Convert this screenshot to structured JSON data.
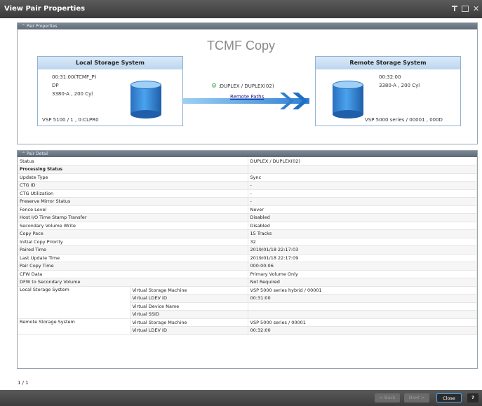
{
  "window": {
    "title": "View Pair Properties"
  },
  "pair_properties": {
    "header": "Pair Properties",
    "copy_type": "TCMF Copy",
    "local": {
      "title": "Local Storage System",
      "line1": "00:31:00(TCMF_P)",
      "line2": "DP",
      "line3": "3380-A , 200 Cyl",
      "footer": "VSP 5100 / 1 , 0:CLPR0"
    },
    "remote": {
      "title": "Remote Storage System",
      "line1": "00:32:00",
      "line2": "3380-A , 200 Cyl",
      "footer": "VSP 5000 series / 00001 , 000D"
    },
    "status": ":DUPLEX / DUPLEX(02)",
    "remote_paths_link": "Remote Paths"
  },
  "pair_detail": {
    "header": "Pair Detail",
    "rows": [
      {
        "label": "Status",
        "value": "DUPLEX / DUPLEX(02)"
      },
      {
        "label": "Processing Status",
        "value": ""
      },
      {
        "label": "Update Type",
        "value": "Sync"
      },
      {
        "label": "CTG ID",
        "value": "-"
      },
      {
        "label": "CTG Utilization",
        "value": "-"
      },
      {
        "label": "Preserve Mirror Status",
        "value": "-"
      },
      {
        "label": "Fence Level",
        "value": "Never"
      },
      {
        "label": "Host I/O Time Stamp Transfer",
        "value": "Disabled"
      },
      {
        "label": "Secondary Volume Write",
        "value": "Disabled"
      },
      {
        "label": "Copy Pace",
        "value": "15 Tracks"
      },
      {
        "label": "Initial Copy Priority",
        "value": "32"
      },
      {
        "label": "Paired Time",
        "value": "2019/01/18 22:17:03"
      },
      {
        "label": "Last Update Time",
        "value": "2019/01/18 22:17:09"
      },
      {
        "label": "Pair Copy Time",
        "value": "000:00:06"
      },
      {
        "label": "CFW Data",
        "value": "Primary Volume Only"
      },
      {
        "label": "DFW to Secondary Volume",
        "value": "Not Required"
      }
    ],
    "local_group": {
      "label": "Local Storage System",
      "rows": [
        {
          "label": "Virtual Storage Machine",
          "value": "VSP 5000 series hybrid / 00001"
        },
        {
          "label": "Virtual LDEV ID",
          "value": "00:31:00"
        },
        {
          "label": "Virtual Device Name",
          "value": ""
        },
        {
          "label": "Virtual SSID",
          "value": ""
        }
      ]
    },
    "remote_group": {
      "label": "Remote Storage System",
      "rows": [
        {
          "label": "Virtual Storage Machine",
          "value": "VSP 5000 series / 00001"
        },
        {
          "label": "Virtual LDEV ID",
          "value": "00:32:00"
        }
      ]
    }
  },
  "pagination": "1 / 1",
  "buttons": {
    "back": "< Back",
    "next": "Next >",
    "close": "Close",
    "help": "?"
  },
  "colors": {
    "accent": "#2f7fd1",
    "link": "#1a1a8c"
  }
}
